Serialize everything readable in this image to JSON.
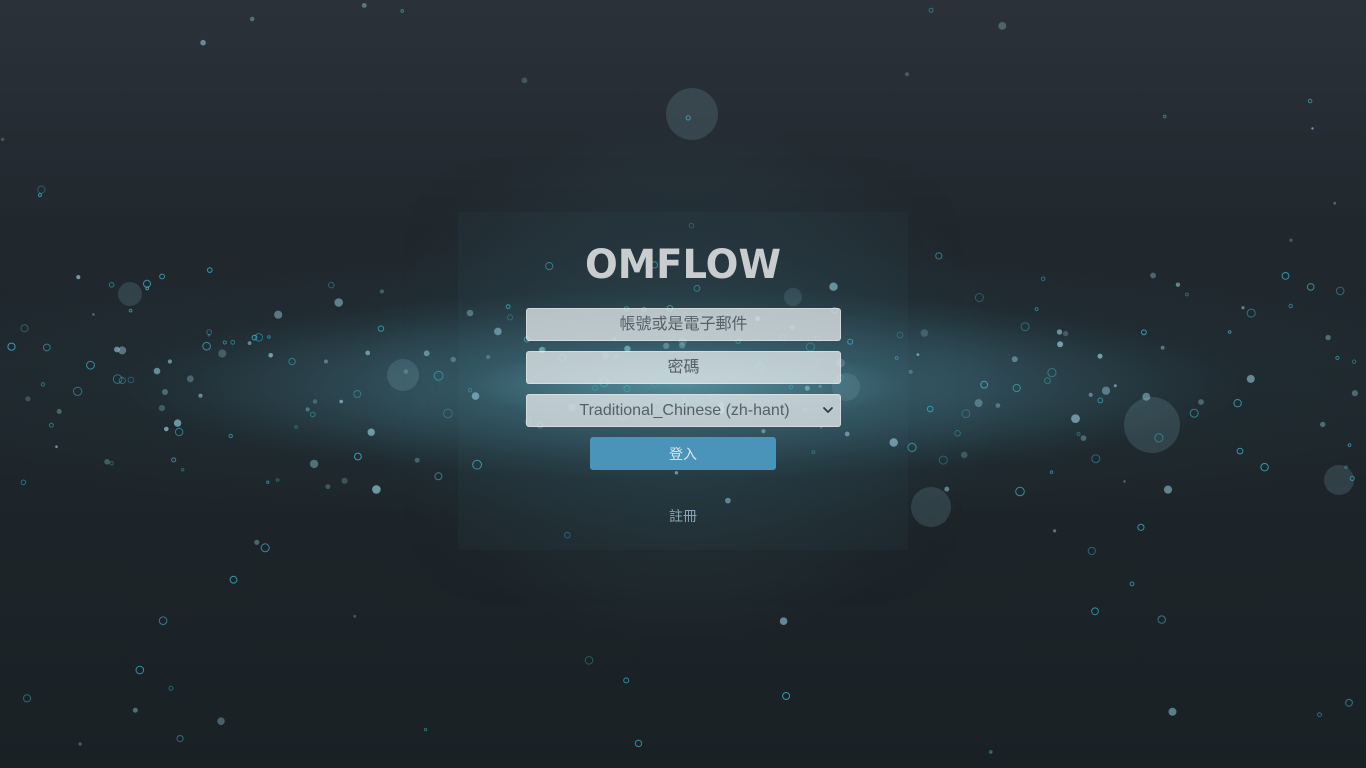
{
  "brand": {
    "logo_text": "OMFLOW",
    "logo_color": "#c9cdcf"
  },
  "form": {
    "account_placeholder": "帳號或是電子郵件",
    "password_placeholder": "密碼",
    "language_selected": "Traditional_Chinese (zh-hant)",
    "language_icon": "chevron-down-icon",
    "login_label": "登入",
    "register_label": "註冊"
  },
  "colors": {
    "background": "#1e262b",
    "glow": "#7ac3d7",
    "button": "#4b94b9",
    "link": "#8aa6b2",
    "bubble": "#3fb6c8"
  }
}
